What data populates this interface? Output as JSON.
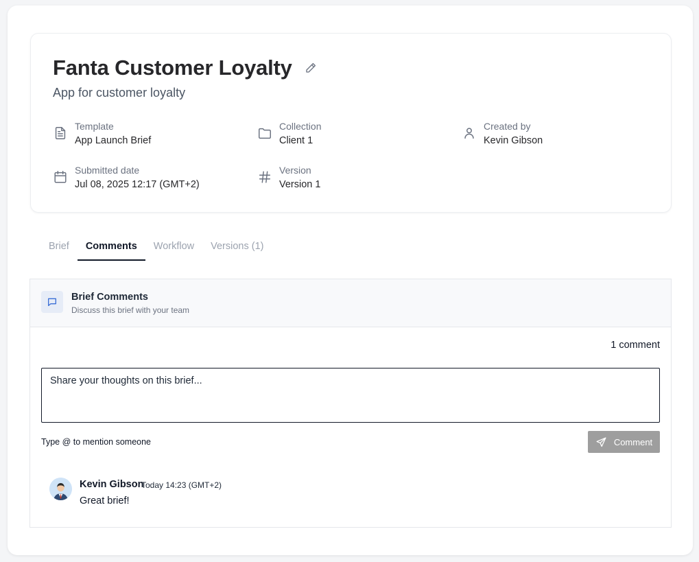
{
  "brief": {
    "title": "Fanta Customer Loyalty",
    "subtitle": "App for customer loyalty"
  },
  "meta": {
    "template": {
      "label": "Template",
      "value": "App Launch Brief",
      "icon": "document-icon"
    },
    "collection": {
      "label": "Collection",
      "value": "Client 1",
      "icon": "folder-icon"
    },
    "created_by": {
      "label": "Created by",
      "value": "Kevin Gibson",
      "icon": "user-icon"
    },
    "submitted": {
      "label": "Submitted date",
      "value": "Jul 08, 2025 12:17 (GMT+2)",
      "icon": "calendar-icon"
    },
    "version": {
      "label": "Version",
      "value": "Version 1",
      "icon": "hash-icon"
    }
  },
  "tabs": [
    {
      "label": "Brief",
      "active": false
    },
    {
      "label": "Comments",
      "active": true
    },
    {
      "label": "Workflow",
      "active": false
    },
    {
      "label": "Versions (1)",
      "active": false
    }
  ],
  "comments": {
    "title": "Brief Comments",
    "subtitle": "Discuss this brief with your team",
    "count_text": "1 comment",
    "input_placeholder": "Share your thoughts on this brief...",
    "mention_hint": "Type @ to mention someone",
    "submit_label": "Comment",
    "items": [
      {
        "author": "Kevin Gibson",
        "time": "Today 14:23 (GMT+2)",
        "text": "Great brief!"
      }
    ]
  },
  "colors": {
    "accent_blue": "#3b6fd6",
    "button_disabled": "#9e9e9e",
    "tab_active": "#111827"
  }
}
